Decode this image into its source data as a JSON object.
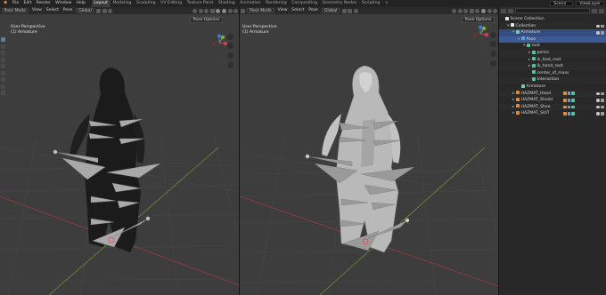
{
  "app": {
    "logo": "⬢",
    "menus": [
      "File",
      "Edit",
      "Render",
      "Window",
      "Help"
    ],
    "workspaces": [
      "Layout",
      "Modeling",
      "Sculpting",
      "UV Editing",
      "Texture Paint",
      "Shading",
      "Animation",
      "Rendering",
      "Compositing",
      "Geometry Nodes",
      "Scripting"
    ],
    "active_workspace": "Layout",
    "add_tab": "+",
    "scene": "Scene",
    "view_layer": "ViewLayer"
  },
  "viewports": [
    {
      "mode": "Pose Mode",
      "menus": [
        "View",
        "Select",
        "Pose"
      ],
      "transform": "Global",
      "pose_options": "Pose Options",
      "info_line1": "User Perspective",
      "info_line2": "(1) Armature",
      "shading": "solid-dark"
    },
    {
      "mode": "Pose Mode",
      "menus": [
        "View",
        "Select",
        "Pose"
      ],
      "transform": "Global",
      "pose_options": "Pose Options",
      "info_line1": "User Perspective",
      "info_line2": "(1) Armature",
      "shading": "solid-light"
    }
  ],
  "outliner": {
    "rows": [
      {
        "label": "Scene Collection",
        "indent": 0,
        "icon": "col",
        "twisty": "",
        "selected": false,
        "visible": false
      },
      {
        "label": "Collection",
        "indent": 1,
        "icon": "col",
        "twisty": "▾",
        "selected": false,
        "visible": true
      },
      {
        "label": "Armature",
        "indent": 2,
        "icon": "arm",
        "twisty": "▾",
        "selected": true,
        "visible": true
      },
      {
        "label": "Pose",
        "indent": 3,
        "icon": "pose",
        "twisty": "▾",
        "selected": true,
        "visible": false
      },
      {
        "label": "root",
        "indent": 4,
        "icon": "bone",
        "twisty": "▾",
        "selected": false,
        "visible": false
      },
      {
        "label": "pelvis",
        "indent": 5,
        "icon": "bone",
        "twisty": "▸",
        "selected": false,
        "visible": false
      },
      {
        "label": "ik_foot_root",
        "indent": 5,
        "icon": "bone",
        "twisty": "▸",
        "selected": false,
        "visible": false
      },
      {
        "label": "ik_hand_root",
        "indent": 5,
        "icon": "bone",
        "twisty": "▸",
        "selected": false,
        "visible": false
      },
      {
        "label": "center_of_mass",
        "indent": 5,
        "icon": "bone",
        "twisty": "",
        "selected": false,
        "visible": false
      },
      {
        "label": "interaction",
        "indent": 5,
        "icon": "bone",
        "twisty": "",
        "selected": false,
        "visible": false
      },
      {
        "label": "Armature",
        "indent": 3,
        "icon": "arm",
        "twisty": "",
        "selected": false,
        "visible": false
      },
      {
        "label": "HAZMAT_Hood",
        "indent": 2,
        "icon": "mesh",
        "twisty": "▸",
        "selected": false,
        "visible": true
      },
      {
        "label": "HAZMAT_Shield",
        "indent": 2,
        "icon": "mesh",
        "twisty": "▸",
        "selected": false,
        "visible": true
      },
      {
        "label": "HAZMAT_Shoe",
        "indent": 2,
        "icon": "mesh",
        "twisty": "▸",
        "selected": false,
        "visible": true
      },
      {
        "label": "HAZMAT_SUIT",
        "indent": 2,
        "icon": "mesh",
        "twisty": "▸",
        "selected": false,
        "visible": true
      }
    ]
  },
  "colors": {
    "accent": "#4772b3",
    "x_axis": "#c2464d",
    "y_axis": "#7fb03a",
    "z_axis": "#3f74c9"
  }
}
